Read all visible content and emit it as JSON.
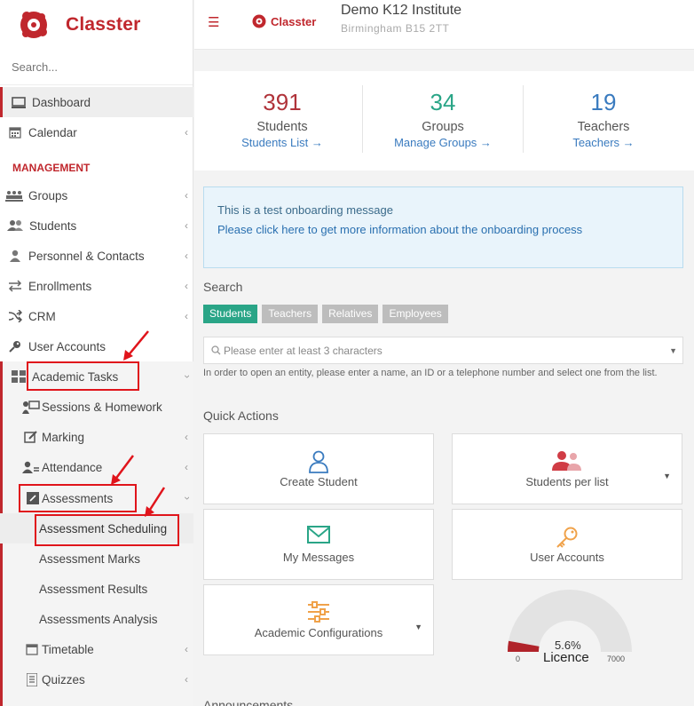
{
  "brand": {
    "name": "Classter",
    "small_name": "Classter",
    "color": "#c0272d"
  },
  "sidebar": {
    "search_placeholder": "Search...",
    "section_title": "MANAGEMENT",
    "items": [
      {
        "label": "Dashboard",
        "icon": "monitor-icon"
      },
      {
        "label": "Calendar",
        "icon": "calendar-icon"
      },
      {
        "label": "Groups",
        "icon": "groups-icon"
      },
      {
        "label": "Students",
        "icon": "students-icon"
      },
      {
        "label": "Personnel & Contacts",
        "icon": "person-icon"
      },
      {
        "label": "Enrollments",
        "icon": "arrows-icon"
      },
      {
        "label": "CRM",
        "icon": "shuffle-icon"
      },
      {
        "label": "User Accounts",
        "icon": "key-icon"
      },
      {
        "label": "Academic Tasks",
        "icon": "grid-icon"
      },
      {
        "label": "Sessions & Homework",
        "icon": "presentation-icon"
      },
      {
        "label": "Marking",
        "icon": "edit-icon"
      },
      {
        "label": "Attendance",
        "icon": "attendance-icon"
      },
      {
        "label": "Assessments",
        "icon": "pencil-square-icon"
      },
      {
        "label": "Assessment Scheduling"
      },
      {
        "label": "Assessment Marks"
      },
      {
        "label": "Assessment Results"
      },
      {
        "label": "Assessments Analysis"
      },
      {
        "label": "Timetable",
        "icon": "calendar-icon"
      },
      {
        "label": "Quizzes",
        "icon": "list-icon"
      }
    ]
  },
  "header": {
    "institute_name": "Demo K12 Institute",
    "institute_address": "Birmingham B15 2TT"
  },
  "stats": [
    {
      "value": "391",
      "label": "Students",
      "link": "Students List →",
      "color": "#b0333a"
    },
    {
      "value": "34",
      "label": "Groups",
      "link": "Manage Groups →",
      "color": "#2aa587"
    },
    {
      "value": "19",
      "label": "Teachers",
      "link": "Teachers →",
      "color": "#3a7bbf"
    }
  ],
  "notice": {
    "line1": "This is a test onboarding message",
    "line2": "Please click here to get more information about the onboarding process"
  },
  "search": {
    "title": "Search",
    "tabs": [
      "Students",
      "Teachers",
      "Relatives",
      "Employees"
    ],
    "active_tab": "Students",
    "placeholder": "Please enter at least 3 characters",
    "helper": "In order to open an entity, please enter a name, an ID or a telephone number and select one from the list."
  },
  "quick_actions": {
    "title": "Quick Actions",
    "cards": [
      {
        "label": "Create Student",
        "icon": "user-outline-icon",
        "dropdown": false
      },
      {
        "label": "Students per list",
        "icon": "users-icon",
        "dropdown": true
      },
      {
        "label": "My Messages",
        "icon": "envelope-icon",
        "dropdown": false
      },
      {
        "label": "User Accounts",
        "icon": "key-icon",
        "dropdown": false
      },
      {
        "label": "Academic Configurations",
        "icon": "sliders-icon",
        "dropdown": true
      }
    ]
  },
  "licence": {
    "percent": "5.6%",
    "label": "Licence",
    "min": "0",
    "max": "7000",
    "fraction": 0.056
  },
  "announcements_title": "Announcements"
}
